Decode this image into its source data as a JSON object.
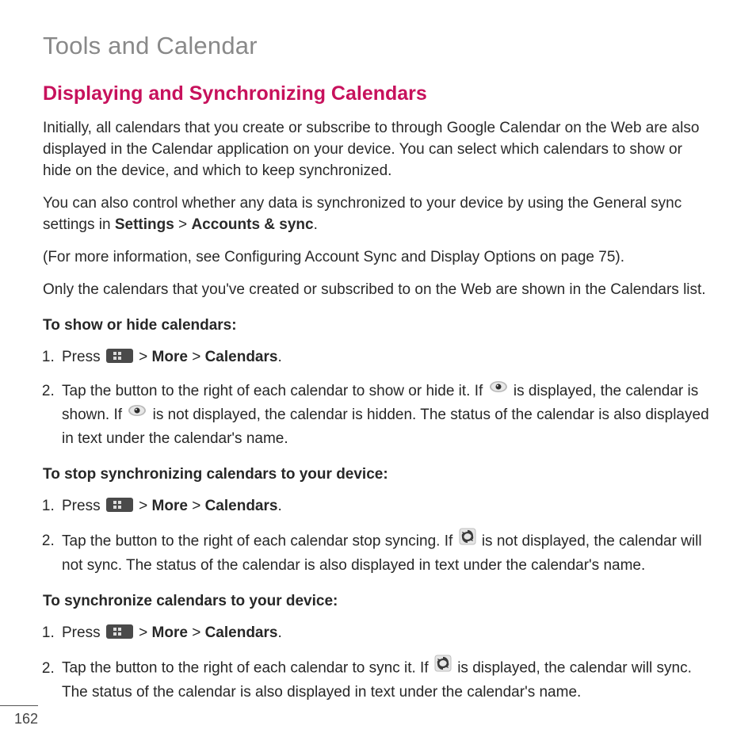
{
  "chapter": "Tools and Calendar",
  "section": "Displaying and Synchronizing Calendars",
  "para1": "Initially, all calendars that you create or subscribe to through Google Calendar on the Web are also displayed in the Calendar application on your device. You can select which calendars to show or hide on the device, and which to keep synchronized.",
  "para2_a": "You can also control whether any data is synchronized to your device by using the General sync settings in ",
  "para2_b": "Settings",
  "para2_c": " > ",
  "para2_d": "Accounts & sync",
  "para2_e": ".",
  "para3": "(For more information, see Configuring Account Sync and Display Options on page 75).",
  "para4": "Only the calendars that you've created or subscribed to on the Web are shown in the Calendars list.",
  "sub1": "To show or hide calendars:",
  "s1_li1_a": "Press ",
  "s1_li1_b": " > ",
  "s1_li1_more": "More",
  "s1_li1_c": " > ",
  "s1_li1_cal": "Calendars",
  "s1_li1_d": ".",
  "s1_li2_a": "Tap the button to the right of each calendar to show or hide it. If ",
  "s1_li2_b": " is displayed, the calendar is shown. If ",
  "s1_li2_c": " is not displayed, the calendar is hidden. The status of the calendar is also displayed in text under the calendar's name.",
  "sub2": "To stop synchronizing calendars to your device:",
  "s2_li1_a": "Press ",
  "s2_li1_b": " > ",
  "s2_li1_more": "More",
  "s2_li1_c": " > ",
  "s2_li1_cal": "Calendars",
  "s2_li1_d": ".",
  "s2_li2_a": "Tap the button to the right of each calendar stop syncing. If ",
  "s2_li2_b": " is not displayed, the calendar will not sync. The status of the calendar is also displayed in text under the calendar's name.",
  "sub3": "To synchronize calendars to your device:",
  "s3_li1_a": "Press ",
  "s3_li1_b": " > ",
  "s3_li1_more": "More",
  "s3_li1_c": " > ",
  "s3_li1_cal": "Calendars",
  "s3_li1_d": ".",
  "s3_li2_a": "Tap the button to the right of each calendar to sync it. If ",
  "s3_li2_b": " is displayed, the calendar will sync. The status of the calendar is also displayed in text under the calendar's name.",
  "page_number": "162"
}
